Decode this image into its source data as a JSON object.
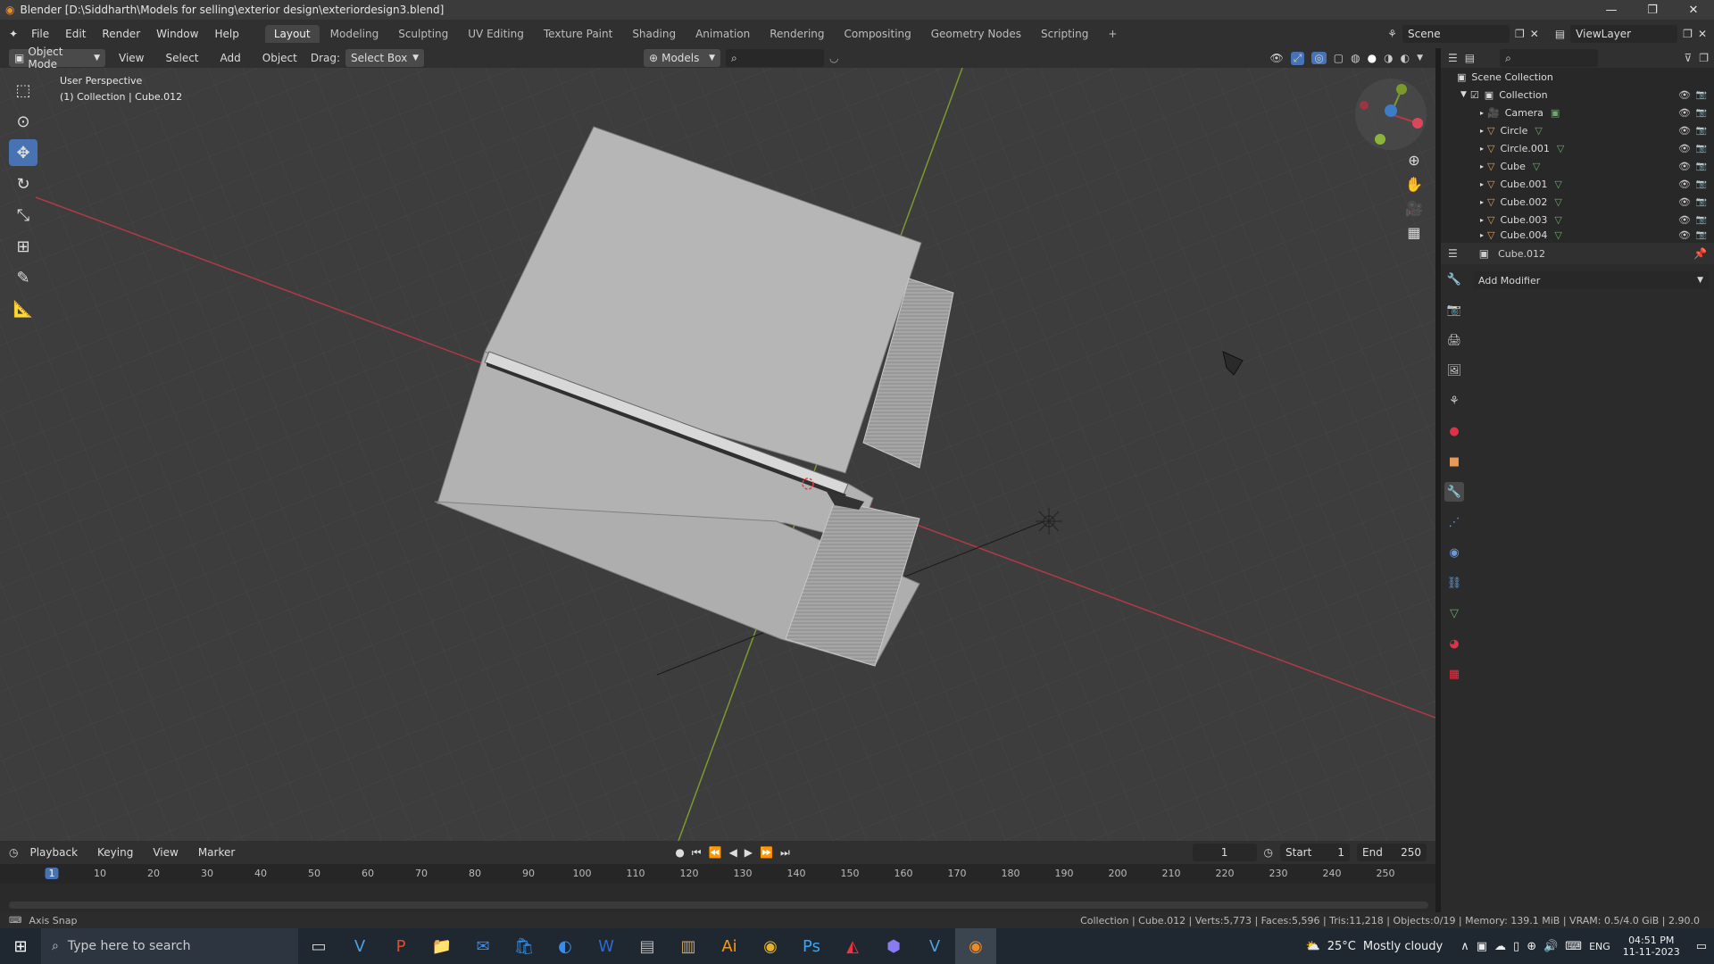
{
  "window": {
    "title": "Blender [D:\\Siddharth\\Models for selling\\exterior design\\exteriordesign3.blend]"
  },
  "menu": [
    "File",
    "Edit",
    "Render",
    "Window",
    "Help"
  ],
  "workspaces": [
    "Layout",
    "Modeling",
    "Sculpting",
    "UV Editing",
    "Texture Paint",
    "Shading",
    "Animation",
    "Rendering",
    "Compositing",
    "Geometry Nodes",
    "Scripting"
  ],
  "active_workspace": "Layout",
  "scene": {
    "label": "Scene",
    "viewlayer": "ViewLayer"
  },
  "viewport_header": {
    "mode": "Object Mode",
    "view": "View",
    "select": "Select",
    "add": "Add",
    "object": "Object",
    "drag_label": "Drag:",
    "drag_value": "Select Box",
    "transform": "Models"
  },
  "viewport": {
    "perspective": "User Perspective",
    "collection": "(1) Collection | Cube.012"
  },
  "outliner": {
    "root": "Scene Collection",
    "collection": "Collection",
    "items": [
      "Camera",
      "Circle",
      "Circle.001",
      "Cube",
      "Cube.001",
      "Cube.002",
      "Cube.003",
      "Cube.004"
    ]
  },
  "properties": {
    "object_name": "Cube.012",
    "add_modifier": "Add Modifier"
  },
  "timeline": {
    "menus": [
      "Playback",
      "Keying",
      "View",
      "Marker"
    ],
    "current_frame": "1",
    "start_label": "Start",
    "start": "1",
    "end_label": "End",
    "end": "250",
    "ticks": [
      "1",
      "10",
      "20",
      "30",
      "40",
      "50",
      "60",
      "70",
      "80",
      "90",
      "100",
      "110",
      "120",
      "130",
      "140",
      "150",
      "160",
      "170",
      "180",
      "190",
      "200",
      "210",
      "220",
      "230",
      "240",
      "250"
    ]
  },
  "status": {
    "left": "Axis Snap",
    "right": "Collection | Cube.012 | Verts:5,773 | Faces:5,596 | Tris:11,218 | Objects:0/19 | Memory: 139.1 MiB | VRAM: 0.5/4.0 GiB | 2.90.0"
  },
  "taskbar": {
    "search": "Type here to search",
    "weather_temp": "25°C",
    "weather_desc": "Mostly cloudy",
    "lang": "ENG",
    "time": "04:51 PM",
    "date": "11-11-2023"
  },
  "colors": {
    "accent": "#4772b3",
    "x_axis": "#b03a48",
    "y_axis": "#7a9a2e"
  }
}
